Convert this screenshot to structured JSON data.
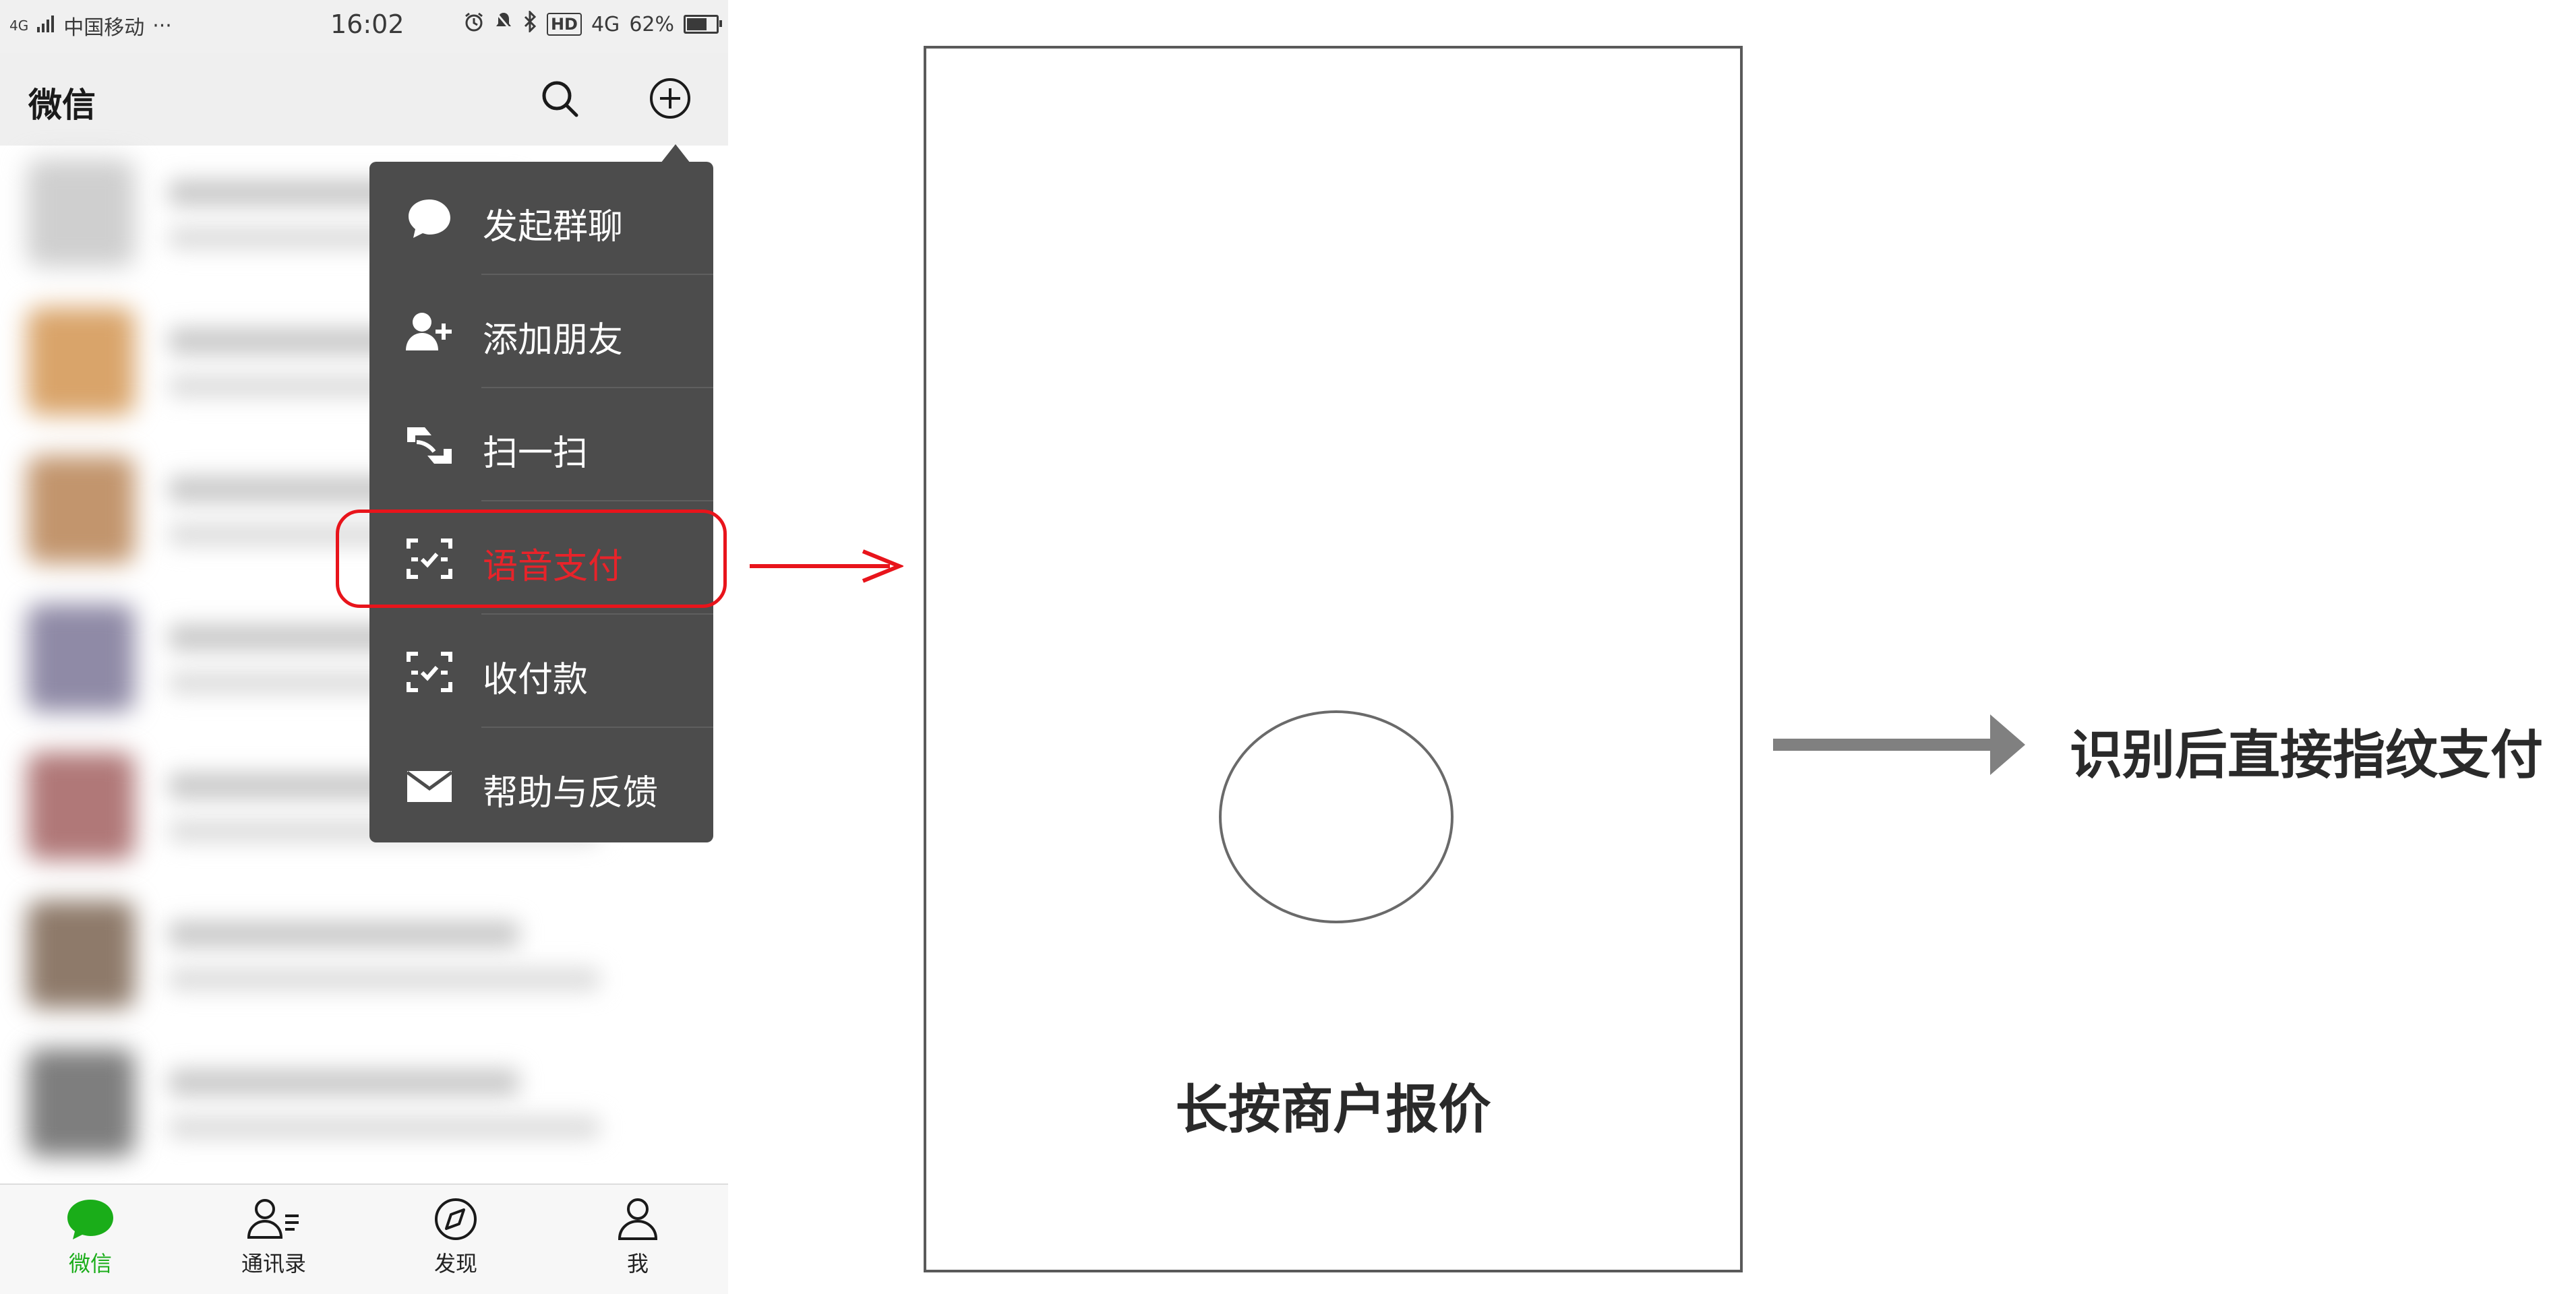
{
  "status_bar": {
    "signal": "4G",
    "carrier": "中国移动",
    "more": "···",
    "time": "16:02",
    "hd": "HD",
    "network": "4G",
    "battery": "62%",
    "battery_level": 0.62
  },
  "app_bar": {
    "title": "微信",
    "search_icon": "search-icon",
    "add_icon": "plus-circle-icon"
  },
  "popup_menu": {
    "items": [
      {
        "label": "发起群聊",
        "icon": "chat-bubble-icon"
      },
      {
        "label": "添加朋友",
        "icon": "add-friend-icon"
      },
      {
        "label": "扫一扫",
        "icon": "scan-icon"
      },
      {
        "label": "语音支付",
        "icon": "pay-scan-icon",
        "highlighted": true
      },
      {
        "label": "收付款",
        "icon": "pay-scan-icon"
      },
      {
        "label": "帮助与反馈",
        "icon": "mail-icon"
      }
    ]
  },
  "tab_bar": {
    "tabs": [
      {
        "label": "微信",
        "icon": "chat-bubble-icon",
        "active": true
      },
      {
        "label": "通讯录",
        "icon": "contacts-icon"
      },
      {
        "label": "发现",
        "icon": "compass-icon"
      },
      {
        "label": "我",
        "icon": "profile-icon"
      }
    ]
  },
  "wireframe": {
    "caption": "长按商户报价"
  },
  "result_text": "识别后直接指纹支付",
  "colors": {
    "accent_green": "#1aad19",
    "highlight_red": "#e8141b",
    "menu_bg": "#4c4c4c",
    "arrow_gray": "#808080"
  }
}
